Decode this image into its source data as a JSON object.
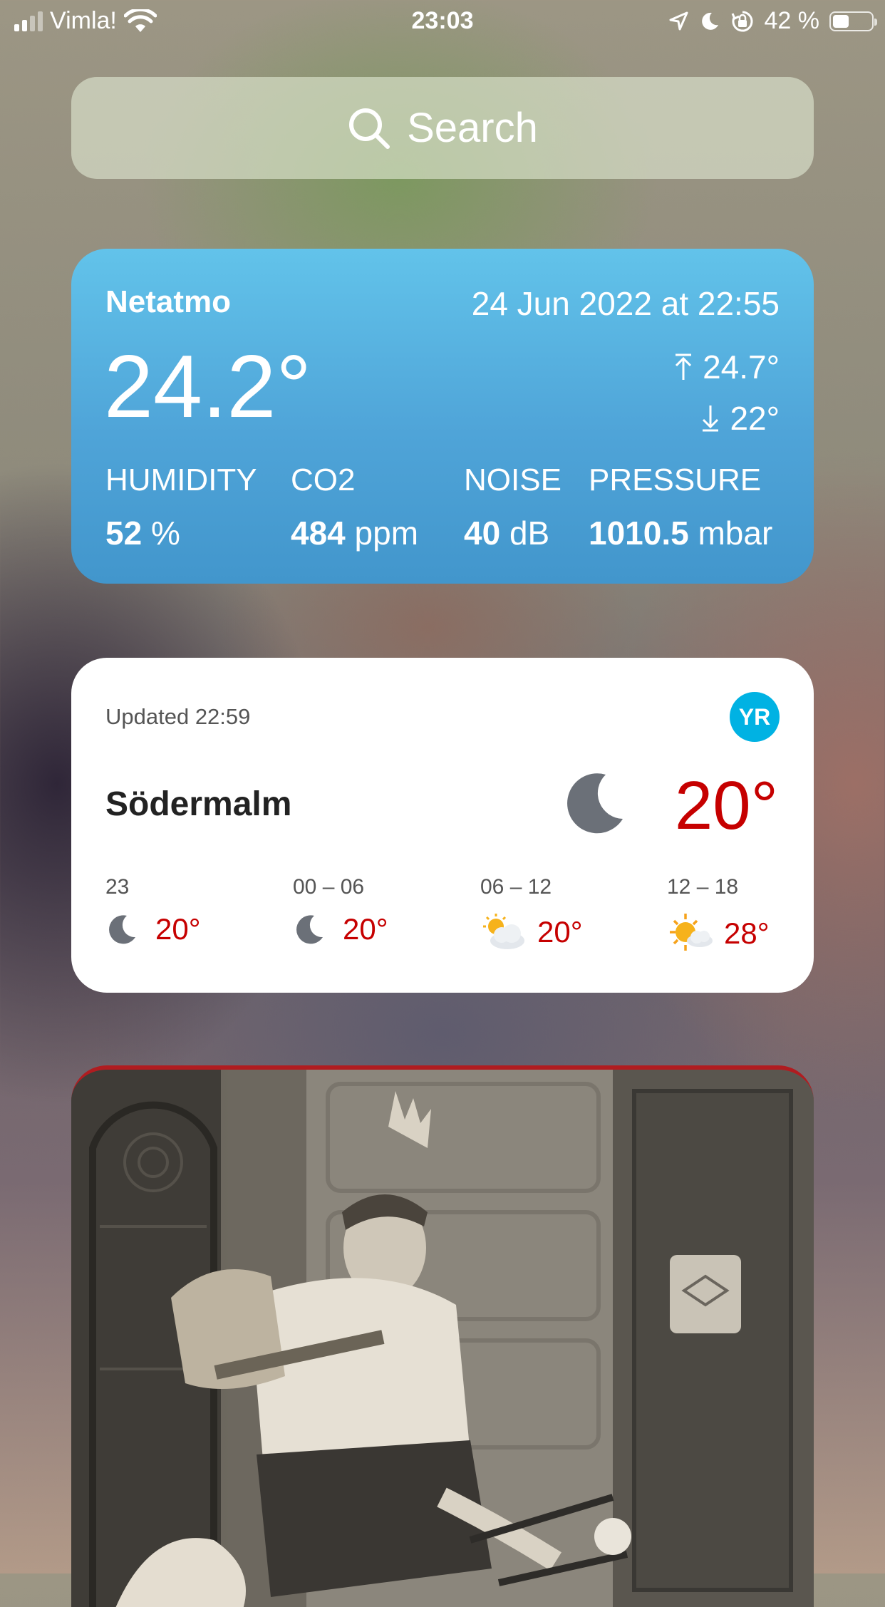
{
  "status_bar": {
    "carrier": "Vimla!",
    "time": "23:03",
    "battery_percent": "42 %",
    "battery_level": 0.42,
    "icons": [
      "signal-icon",
      "wifi-icon",
      "location-icon",
      "moon-icon",
      "rotation-lock-icon",
      "battery-icon"
    ]
  },
  "search": {
    "label": "Search",
    "icon": "search-icon"
  },
  "netatmo": {
    "title": "Netatmo",
    "updated": "24 Jun 2022 at 22:55",
    "temperature": "24.2°",
    "high": "24.7°",
    "low": "22°",
    "metrics": [
      {
        "label": "HUMIDITY",
        "value": "52",
        "unit": "%"
      },
      {
        "label": "CO2",
        "value": "484",
        "unit": "ppm"
      },
      {
        "label": "NOISE",
        "value": "40",
        "unit": "dB"
      },
      {
        "label": "PRESSURE",
        "value": "1010.5",
        "unit": "mbar"
      }
    ],
    "colors": {
      "top": "#62c3ea",
      "bottom": "#4296cc"
    }
  },
  "yr": {
    "updated": "Updated 22:59",
    "logo": "YR",
    "place": "Södermalm",
    "current_icon": "moon-icon",
    "current_temp": "20°",
    "forecast": [
      {
        "period": "23",
        "icon": "moon-icon",
        "temp": "20°"
      },
      {
        "period": "00 – 06",
        "icon": "moon-icon",
        "temp": "20°"
      },
      {
        "period": "06 – 12",
        "icon": "partly-cloudy-icon",
        "temp": "20°"
      },
      {
        "period": "12 – 18",
        "icon": "sun-cloud-icon",
        "temp": "28°"
      }
    ],
    "colors": {
      "temp": "#c60000",
      "logo": "#00b2e3"
    }
  },
  "photo": {
    "icon": "photo-widget-image"
  }
}
